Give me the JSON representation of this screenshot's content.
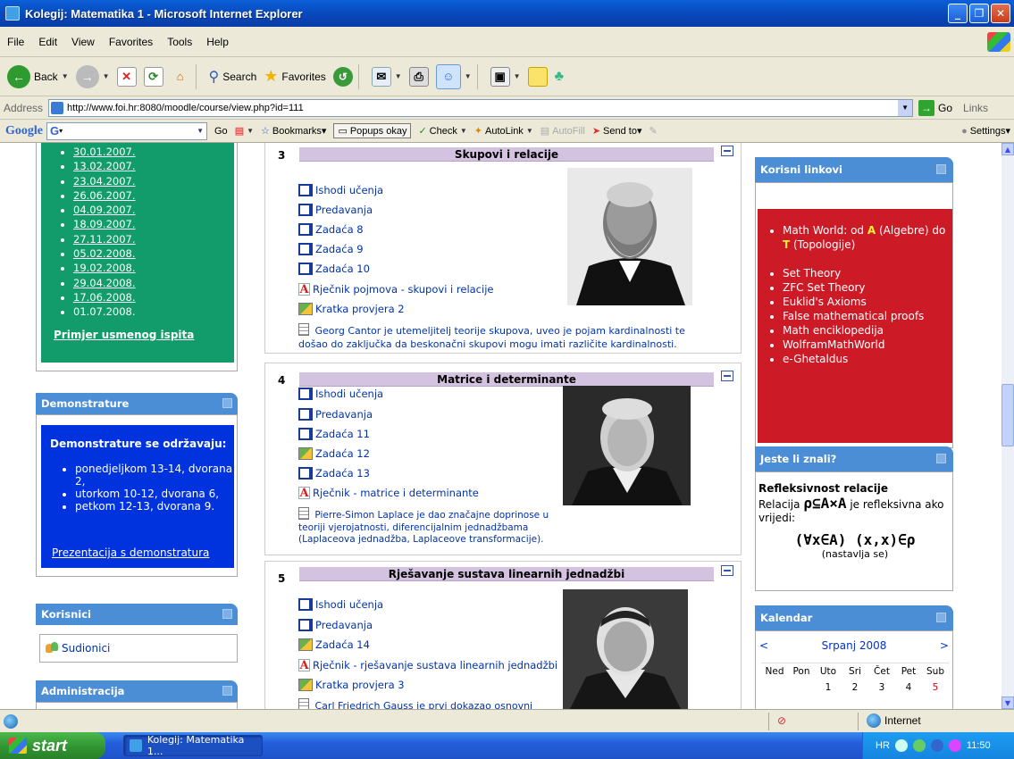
{
  "window": {
    "title": "Kolegij: Matematika 1 - Microsoft Internet Explorer"
  },
  "menu": [
    "File",
    "Edit",
    "View",
    "Favorites",
    "Tools",
    "Help"
  ],
  "toolbar": {
    "back": "Back",
    "search": "Search",
    "favorites": "Favorites"
  },
  "address": {
    "label": "Address",
    "url": "http://www.foi.hr:8080/moodle/course/view.php?id=111",
    "go": "Go",
    "links": "Links"
  },
  "google_bar": {
    "logo": "Google",
    "go": "Go",
    "bookmarks": "Bookmarks▾",
    "popups": "Popups okay",
    "check": "Check",
    "autolink": "AutoLink",
    "autofill": "AutoFill",
    "sendto": "Send to▾",
    "settings": "Settings▾"
  },
  "left": {
    "dates": [
      "30.01.2007.",
      "13.02.2007.",
      "23.04.2007.",
      "26.06.2007.",
      "04.09.2007.",
      "18.09.2007.",
      "27.11.2007.",
      "05.02.2008.",
      "19.02.2008.",
      "29.04.2008.",
      "17.06.2008.",
      "01.07.2008."
    ],
    "primjer": "Primjer usmenog ispita",
    "demonstrature": {
      "title": "Demonstrature",
      "header": "Demonstrature se održavaju:",
      "items": [
        "ponedjeljkom 13-14, dvorana 2,",
        "utorkom 10-12, dvorana 6,",
        "petkom 12-13, dvorana 9."
      ],
      "link": "Prezentacija s demonstratura"
    },
    "korisnici": {
      "title": "Korisnici",
      "sudionici": "Sudionici"
    },
    "administracija": {
      "title": "Administracija"
    }
  },
  "topics": [
    {
      "num": "3",
      "title": "Skupovi i relacije",
      "items": [
        {
          "type": "page",
          "label": "Ishodi učenja"
        },
        {
          "type": "page",
          "label": "Predavanja"
        },
        {
          "type": "page",
          "label": "Zadaća 8"
        },
        {
          "type": "page",
          "label": "Zadaća 9"
        },
        {
          "type": "page",
          "label": "Zadaća 10"
        },
        {
          "type": "gloss",
          "label": "Rječnik pojmova - skupovi i relacije"
        },
        {
          "type": "assign",
          "label": "Kratka provjera 2"
        }
      ],
      "summary": "Georg Cantor je utemeljitelj teorije skupova, uveo je pojam kardinalnosti te došao do zaključka da beskonačni skupovi mogu imati različite kardinalnosti."
    },
    {
      "num": "4",
      "title": "Matrice i determinante",
      "items": [
        {
          "type": "page",
          "label": "Ishodi učenja"
        },
        {
          "type": "page",
          "label": "Predavanja"
        },
        {
          "type": "page",
          "label": "Zadaća 11"
        },
        {
          "type": "assign",
          "label": "Zadaća 12"
        },
        {
          "type": "page",
          "label": "Zadaća 13"
        },
        {
          "type": "gloss",
          "label": "Rječnik - matrice i determinante"
        }
      ],
      "summary": "Pierre-Simon Laplace je dao značajne doprinose u teoriji vjerojatnosti, diferencijalnim jednadžbama (Laplaceova jednadžba, Laplaceove transformacije)."
    },
    {
      "num": "5",
      "title": "Rješavanje sustava linearnih jednadžbi",
      "items": [
        {
          "type": "page",
          "label": "Ishodi učenja"
        },
        {
          "type": "page",
          "label": "Predavanja"
        },
        {
          "type": "assign",
          "label": "Zadaća 14"
        },
        {
          "type": "gloss",
          "label": "Rječnik - rješavanje sustava linearnih jednadžbi"
        },
        {
          "type": "assign",
          "label": "Kratka provjera 3"
        }
      ],
      "summary": "Carl Friedrich Gauss je prvi dokazao osnovni"
    }
  ],
  "right": {
    "korisni": {
      "title": "Korisni linkovi",
      "mw_prefix": "Math World:  od ",
      "mw_a": "A",
      "mw_mid1": " (Algebre) do ",
      "mw_t": "T",
      "mw_mid2": " (Topologije)",
      "links": [
        "Set Theory",
        "ZFC Set Theory",
        "Euklid's Axioms",
        "False mathematical proofs",
        "Math enciklopedija",
        "WolframMathWorld",
        "e-Ghetaldus"
      ]
    },
    "znali": {
      "title": "Jeste li znali?",
      "heading": "Refleksivnost relacije",
      "relacija": "Relacija",
      "rel_symbol": "ρ⊆A×A",
      "tail": " je refleksivna ako vrijedi:",
      "formula": "(∀x∈A) (x,x)∈ρ",
      "nastavlja": "(nastavlja se)"
    },
    "kalendar": {
      "title": "Kalendar",
      "prev": "<",
      "month": "Srpanj 2008",
      "next": ">",
      "weekdays": [
        "Ned",
        "Pon",
        "Uto",
        "Sri",
        "Čet",
        "Pet",
        "Sub"
      ],
      "week1": [
        "",
        "",
        "1",
        "2",
        "3",
        "4",
        "5"
      ]
    }
  },
  "status": {
    "zone": "Internet"
  },
  "taskbar": {
    "start": "start",
    "item": "Kolegij: Matematika 1...",
    "lang": "HR",
    "time": "11:50"
  }
}
